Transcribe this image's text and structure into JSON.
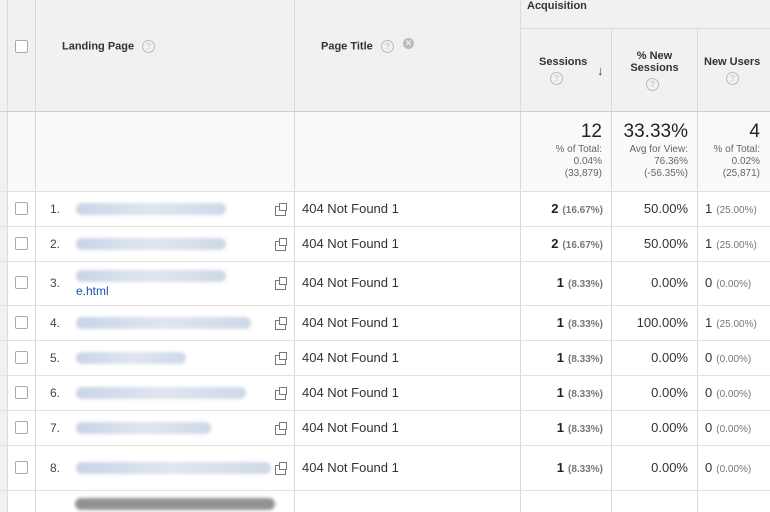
{
  "header": {
    "group_label": "Acquisition",
    "landing_page": "Landing Page",
    "page_title": "Page Title",
    "sessions": "Sessions",
    "new_sessions_line1": "% New",
    "new_sessions_line2": "Sessions",
    "new_users": "New Users",
    "help_glyph": "?",
    "close_glyph": "✕",
    "sort_glyph": "↓"
  },
  "summary": {
    "sessions": {
      "value": "12",
      "line1": "% of Total:",
      "line2": "0.04%",
      "line3": "(33,879)"
    },
    "new_sessions": {
      "value": "33.33%",
      "line1": "Avg for View:",
      "line2": "76.36%",
      "line3": "(-56.35%)"
    },
    "new_users": {
      "value": "4",
      "line1": "% of Total:",
      "line2": "0.02%",
      "line3": "(25,871)"
    }
  },
  "rows": [
    {
      "index": "1.",
      "page_title": "404 Not Found 1",
      "sessions": "2",
      "sessions_pct": "(16.67%)",
      "new_sessions": "50.00%",
      "new_users": "1",
      "new_users_pct": "(25.00%)"
    },
    {
      "index": "2.",
      "page_title": "404 Not Found 1",
      "sessions": "2",
      "sessions_pct": "(16.67%)",
      "new_sessions": "50.00%",
      "new_users": "1",
      "new_users_pct": "(25.00%)"
    },
    {
      "index": "3.",
      "link_suffix": "e.html",
      "page_title": "404 Not Found 1",
      "sessions": "1",
      "sessions_pct": "(8.33%)",
      "new_sessions": "0.00%",
      "new_users": "0",
      "new_users_pct": "(0.00%)"
    },
    {
      "index": "4.",
      "page_title": "404 Not Found 1",
      "sessions": "1",
      "sessions_pct": "(8.33%)",
      "new_sessions": "100.00%",
      "new_users": "1",
      "new_users_pct": "(25.00%)"
    },
    {
      "index": "5.",
      "page_title": "404 Not Found 1",
      "sessions": "1",
      "sessions_pct": "(8.33%)",
      "new_sessions": "0.00%",
      "new_users": "0",
      "new_users_pct": "(0.00%)"
    },
    {
      "index": "6.",
      "page_title": "404 Not Found 1",
      "sessions": "1",
      "sessions_pct": "(8.33%)",
      "new_sessions": "0.00%",
      "new_users": "0",
      "new_users_pct": "(0.00%)"
    },
    {
      "index": "7.",
      "page_title": "404 Not Found 1",
      "sessions": "1",
      "sessions_pct": "(8.33%)",
      "new_sessions": "0.00%",
      "new_users": "0",
      "new_users_pct": "(0.00%)"
    },
    {
      "index": "8.",
      "page_title": "404 Not Found 1",
      "sessions": "1",
      "sessions_pct": "(8.33%)",
      "new_sessions": "0.00%",
      "new_users": "0",
      "new_users_pct": "(0.00%)"
    }
  ]
}
